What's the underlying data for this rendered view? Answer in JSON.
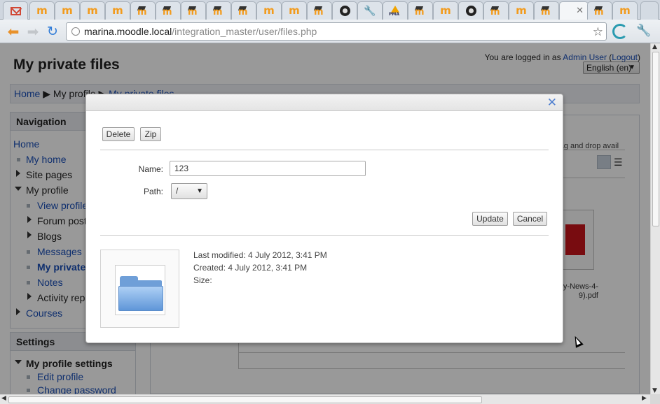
{
  "browser": {
    "tabs": [
      "gmail-icon",
      "moodle-icon",
      "moodle-icon",
      "moodle-icon",
      "moodle-icon",
      "moodle-cap-icon",
      "moodle-cap-icon",
      "moodle-cap-icon",
      "moodle-cap-icon",
      "moodle-cap-icon",
      "moodle-icon",
      "moodle-cap-icon",
      "github-icon",
      "wrench-icon",
      "phpmyadmin-icon",
      "moodle-cap-icon",
      "moodle-icon",
      "github-icon",
      "moodle-cap-icon",
      "moodle-icon",
      "moodle-cap-icon",
      "moodle-active-tab",
      "moodle-cap-icon",
      "moodle-icon"
    ],
    "url_host": "marina.moodle.local",
    "url_path": "/integration_master/user/files.php"
  },
  "header": {
    "logged_in_prefix": "You are logged in as ",
    "user_name": "Admin User",
    "logout_label": "Logout",
    "language": "English (en)"
  },
  "page": {
    "title": "My private files",
    "breadcrumb": {
      "home": "Home",
      "profile": "My profile",
      "current": "My private files"
    },
    "dnd_hint": "rag and drop avail"
  },
  "navigation": {
    "title": "Navigation",
    "home": "Home",
    "my_home": "My home",
    "site_pages": "Site pages",
    "my_profile": "My profile",
    "view_profile": "View profile",
    "forum_posts": "Forum posts",
    "blogs": "Blogs",
    "messages": "Messages",
    "my_private_files": "My private f",
    "notes": "Notes",
    "activity_reports": "Activity repo",
    "courses": "Courses"
  },
  "settings": {
    "title": "Settings",
    "my_profile_settings": "My profile settings",
    "edit_profile": "Edit profile",
    "change_password": "Change password"
  },
  "file_area": {
    "pdf_label_line1": "y-News-4-",
    "pdf_label_line2": "9).pdf"
  },
  "dialog": {
    "close_symbol": "✕",
    "delete_label": "Delete",
    "zip_label": "Zip",
    "name_label": "Name:",
    "name_value": "123",
    "path_label": "Path:",
    "path_value": "/",
    "update_label": "Update",
    "cancel_label": "Cancel",
    "last_modified": "Last modified: 4 July 2012, 3:41 PM",
    "created": "Created: 4 July 2012, 3:41 PM",
    "size": "Size:"
  }
}
